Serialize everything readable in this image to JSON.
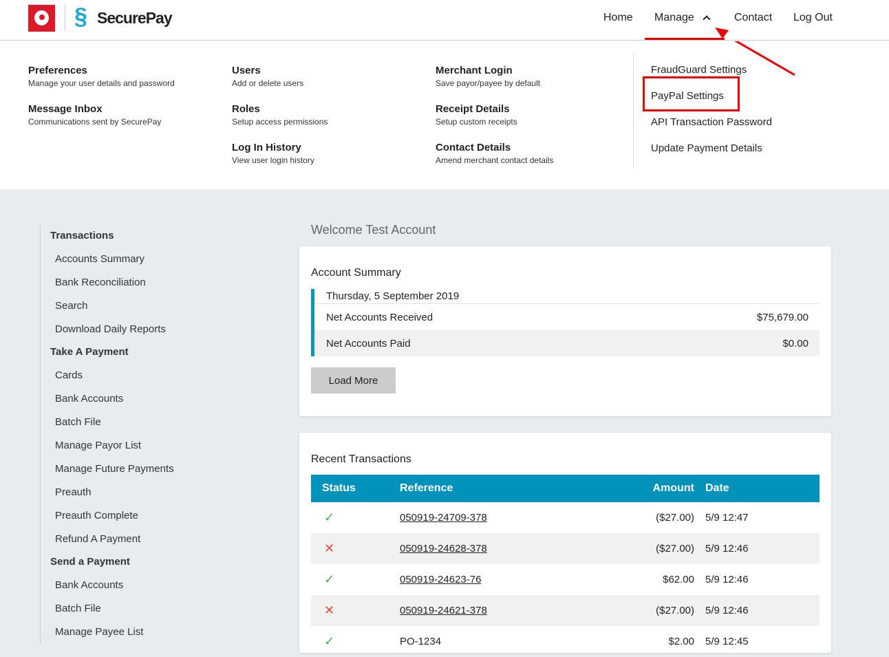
{
  "brand": {
    "name": "SecurePay",
    "accent": "#0192bc",
    "highlight": "#ee0000"
  },
  "nav": {
    "home": "Home",
    "manage": "Manage",
    "contact": "Contact",
    "logout": "Log Out"
  },
  "menu": {
    "columns": [
      [
        {
          "title": "Preferences",
          "desc": "Manage your user details and password"
        },
        {
          "title": "Message Inbox",
          "desc": "Communications sent by SecurePay"
        }
      ],
      [
        {
          "title": "Users",
          "desc": "Add or delete users"
        },
        {
          "title": "Roles",
          "desc": "Setup access permissions"
        },
        {
          "title": "Log In History",
          "desc": "View user login history"
        }
      ],
      [
        {
          "title": "Merchant Login",
          "desc": "Save payor/payee by default"
        },
        {
          "title": "Receipt Details",
          "desc": "Setup custom receipts"
        },
        {
          "title": "Contact Details",
          "desc": "Amend merchant contact details"
        }
      ]
    ],
    "links": [
      "FraudGuard Settings",
      "PayPal Settings",
      "API Transaction Password",
      "Update Payment Details"
    ]
  },
  "sidebar": {
    "sections": [
      {
        "title": "Transactions",
        "items": [
          "Accounts Summary",
          "Bank Reconciliation",
          "Search",
          "Download Daily Reports"
        ]
      },
      {
        "title": "Take A Payment",
        "items": [
          "Cards",
          "Bank Accounts",
          "Batch File",
          "Manage Payor List",
          "Manage Future Payments",
          "Preauth",
          "Preauth Complete",
          "Refund A Payment"
        ]
      },
      {
        "title": "Send a Payment",
        "items": [
          "Bank Accounts",
          "Batch File",
          "Manage Payee List"
        ]
      }
    ]
  },
  "main": {
    "welcome": "Welcome Test Account",
    "summary": {
      "title": "Account Summary",
      "date": "Thursday, 5 September 2019",
      "rows": [
        {
          "label": "Net Accounts Received",
          "value": "$75,679.00"
        },
        {
          "label": "Net Accounts Paid",
          "value": "$0.00"
        }
      ],
      "load_more": "Load More"
    },
    "recent": {
      "title": "Recent Transactions",
      "headers": [
        "Status",
        "Reference",
        "Amount",
        "Date"
      ],
      "rows": [
        {
          "status": "success",
          "status_glyph": "✓",
          "reference": "050919-24709-378",
          "amount": "($27.00)",
          "date": "5/9 12:47",
          "link": true
        },
        {
          "status": "failed",
          "status_glyph": "✕",
          "reference": "050919-24628-378",
          "amount": "($27.00)",
          "date": "5/9 12:46",
          "link": true
        },
        {
          "status": "success",
          "status_glyph": "✓",
          "reference": "050919-24623-76",
          "amount": "$62.00",
          "date": "5/9 12:46",
          "link": true
        },
        {
          "status": "failed",
          "status_glyph": "✕",
          "reference": "050919-24621-378",
          "amount": "($27.00)",
          "date": "5/9 12:46",
          "link": true
        },
        {
          "status": "success",
          "status_glyph": "✓",
          "reference": "PO-1234",
          "amount": "$2.00",
          "date": "5/9 12:45",
          "link": false
        }
      ]
    }
  }
}
